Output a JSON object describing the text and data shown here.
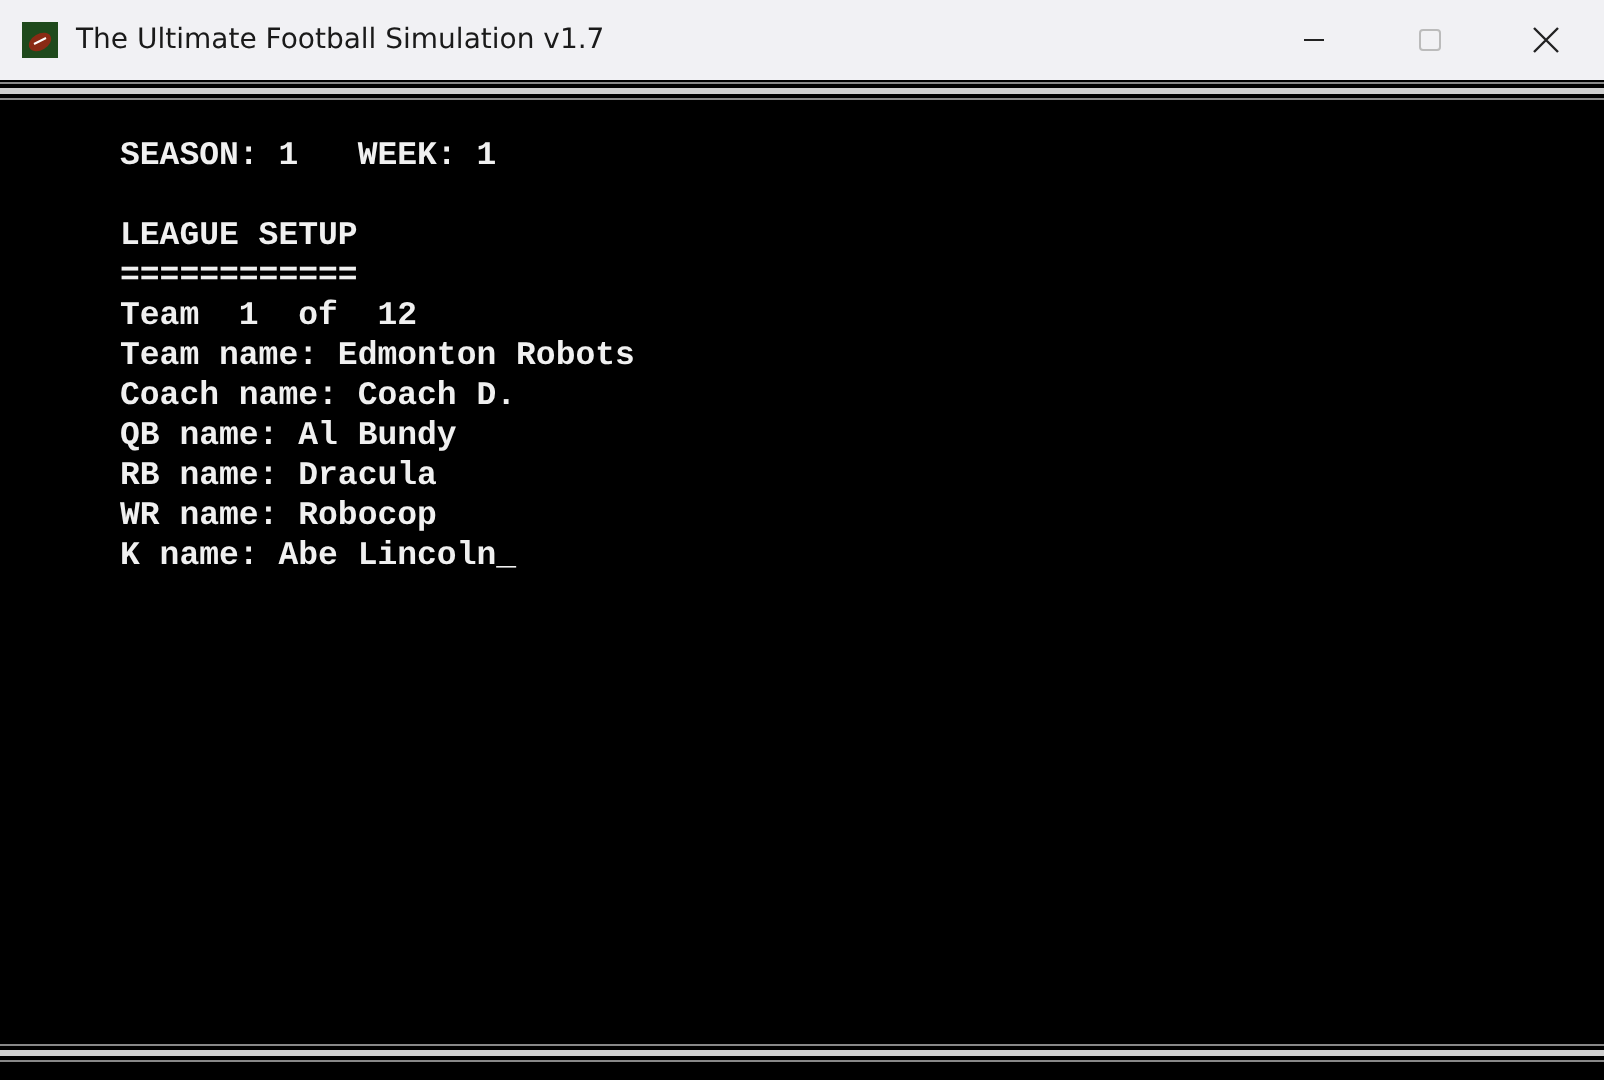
{
  "window": {
    "title": "The Ultimate Football Simulation v1.7"
  },
  "console": {
    "lines": [
      {
        "kind": "text",
        "text": "SEASON: 1   WEEK: 1"
      },
      {
        "kind": "blank"
      },
      {
        "kind": "text",
        "text": "LEAGUE SETUP"
      },
      {
        "kind": "text",
        "text": "============"
      },
      {
        "kind": "text",
        "text": "Team  1  of  12"
      },
      {
        "kind": "text",
        "text": "Team name: Edmonton Robots"
      },
      {
        "kind": "text",
        "text": "Coach name: Coach D."
      },
      {
        "kind": "text",
        "text": "QB name: Al Bundy"
      },
      {
        "kind": "text",
        "text": "RB name: Dracula"
      },
      {
        "kind": "text",
        "text": "WR name: Robocop"
      },
      {
        "kind": "text",
        "text": "K name: Abe Lincoln_"
      }
    ]
  }
}
